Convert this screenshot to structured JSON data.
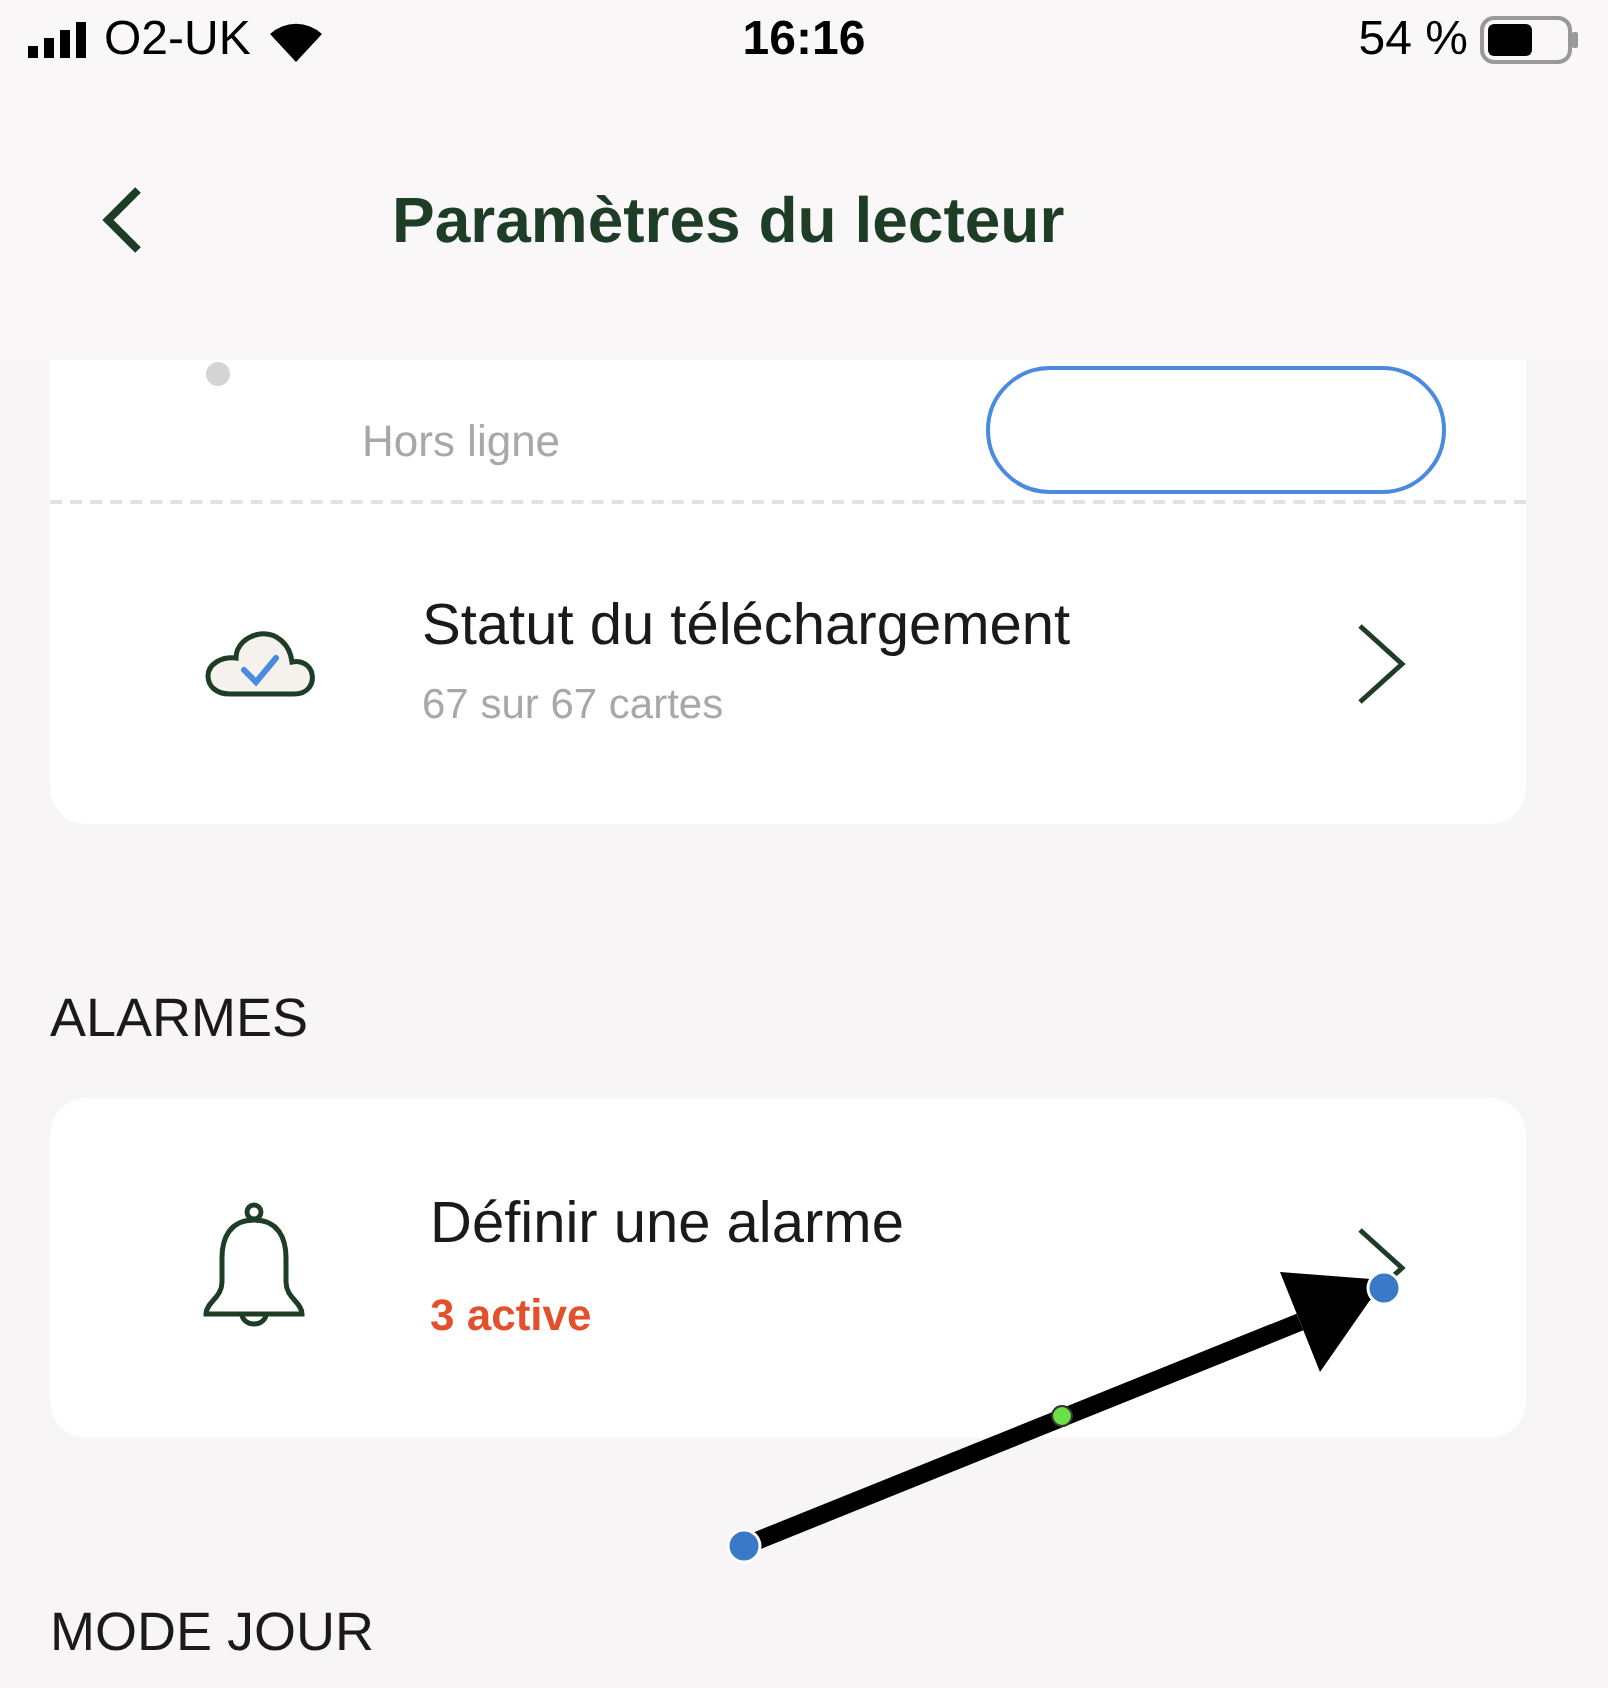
{
  "status_bar": {
    "carrier": "O2-UK",
    "time": "16:16",
    "battery": "54 %"
  },
  "header": {
    "title": "Paramètres du lecteur"
  },
  "player_card": {
    "rows": [
      {
        "kind": "status",
        "subtitle": "Hors ligne"
      },
      {
        "kind": "download",
        "title": "Statut du téléchargement",
        "subtitle": "67 sur 67 cartes"
      }
    ]
  },
  "sections": [
    {
      "heading": "ALARMES",
      "rows": [
        {
          "title": "Définir une alarme",
          "subtitle": "3 active"
        }
      ]
    },
    {
      "heading": "MODE JOUR"
    }
  ]
}
